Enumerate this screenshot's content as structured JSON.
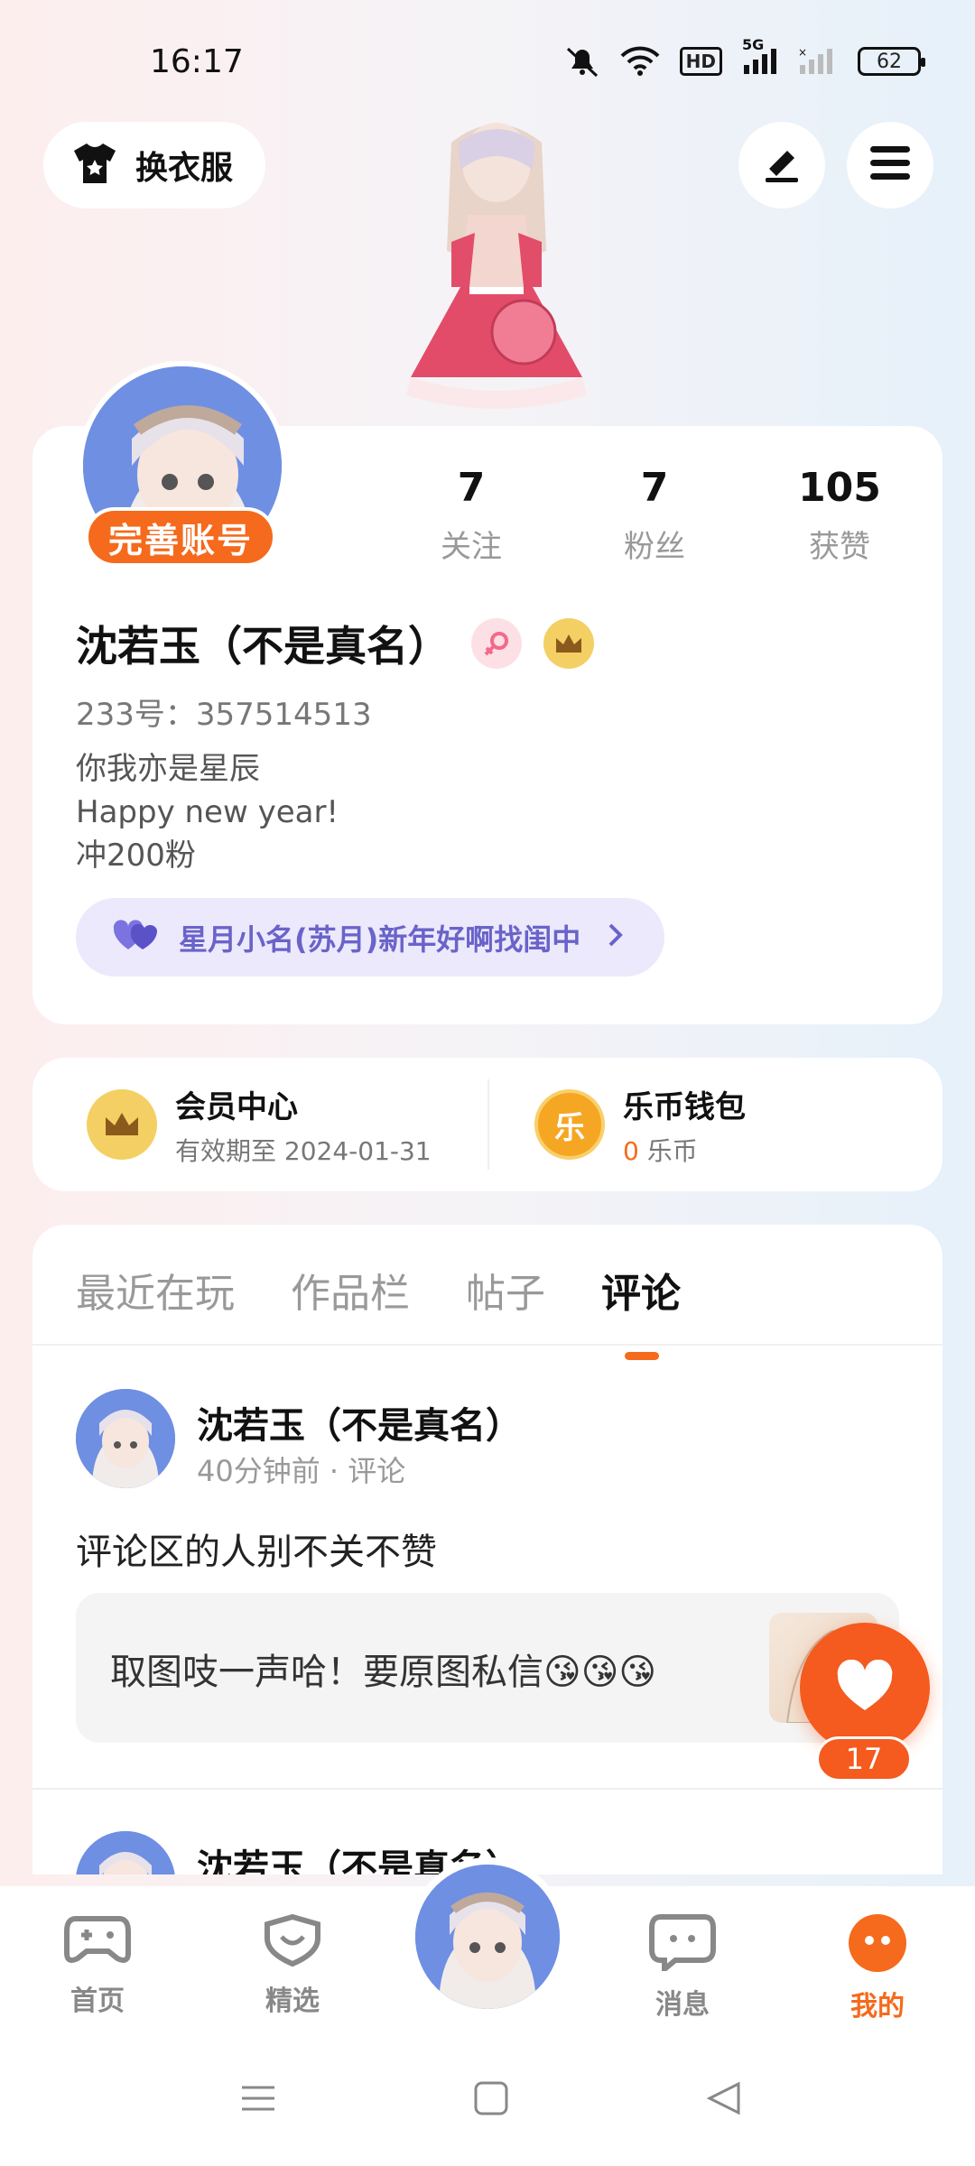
{
  "status_bar": {
    "time": "16:17",
    "network": "5G",
    "hd_label": "HD",
    "battery": "62"
  },
  "header": {
    "outfit_label": "换衣服",
    "edit_icon": "edit-icon",
    "menu_icon": "menu-icon"
  },
  "profile": {
    "complete_label": "完善账号",
    "stats": [
      {
        "value": "7",
        "label": "关注"
      },
      {
        "value": "7",
        "label": "粉丝"
      },
      {
        "value": "105",
        "label": "获赞"
      }
    ],
    "name": "沈若玉（不是真名）",
    "uid": "233号：357514513",
    "bio_lines": [
      "你我亦是星辰",
      "Happy new year!",
      "冲200粉"
    ],
    "voice_pill": "星月小名(苏月)新年好啊找闺中"
  },
  "vip": {
    "member_title": "会员中心",
    "member_sub": "有效期至 2024-01-31",
    "wallet_title": "乐币钱包",
    "wallet_amount": "0",
    "wallet_unit": "乐币",
    "wallet_icon_char": "乐"
  },
  "tabs": [
    "最近在玩",
    "作品栏",
    "帖子",
    "评论"
  ],
  "active_tab": "评论",
  "posts": [
    {
      "author": "沈若玉（不是真名）",
      "meta": "40分钟前 · 评论",
      "text": "评论区的人别不关不赞",
      "quote": "取图吱一声哈！要原图私信😘😘😘"
    },
    {
      "author": "沈若玉（不是真名）"
    }
  ],
  "like": {
    "count": "17"
  },
  "nav": [
    {
      "label": "首页",
      "icon": "gamepad-icon"
    },
    {
      "label": "精选",
      "icon": "heart-box-icon"
    },
    {
      "label": "",
      "icon": "avatar"
    },
    {
      "label": "消息",
      "icon": "chat-icon"
    },
    {
      "label": "我的",
      "icon": "profile-face-icon"
    }
  ],
  "colors": {
    "accent": "#f56a1c",
    "voice": "#6a63c9",
    "gold": "#e8b84a"
  }
}
